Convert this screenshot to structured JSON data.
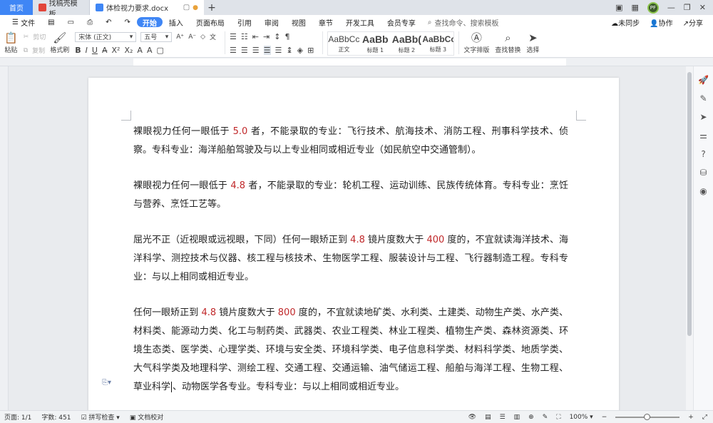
{
  "tabs": {
    "home": "首页",
    "template": "找稿壳模板",
    "document": "体检视力要求.docx"
  },
  "window": {
    "avatar_text": "PF"
  },
  "menu": {
    "file": "文件",
    "items": [
      "开始",
      "插入",
      "页面布局",
      "引用",
      "审阅",
      "视图",
      "章节",
      "开发工具",
      "会员专享"
    ],
    "search_placeholder": "查找命令、搜索模板",
    "sync": "未同步",
    "collab": "协作",
    "share": "分享"
  },
  "ribbon": {
    "cut": "剪切",
    "copy": "复制",
    "paste": "粘贴",
    "format_painter": "格式刷",
    "font_name": "宋体 (正文)",
    "font_size": "五号",
    "styles": [
      "正文",
      "标题 1",
      "标题 2",
      "标题 3"
    ],
    "style_preview": [
      "AaBbCc",
      "AaBb",
      "AaBb(",
      "AaBbCc"
    ],
    "text_layout": "文字排版",
    "find_replace": "查找替换",
    "select": "选择"
  },
  "document": {
    "paragraphs": [
      {
        "pre": "裸眼视力任何一眼低于 ",
        "num": "5.0",
        "post": " 者，不能录取的专业：飞行技术、航海技术、消防工程、刑事科学技术、侦察。专科专业：海洋船舶驾驶及与以上专业相同或相近专业（如民航空中交通管制）。"
      },
      {
        "pre": "裸眼视力任何一眼低于 ",
        "num": "4.8",
        "post": " 者，不能录取的专业：轮机工程、运动训练、民族传统体育。专科专业：烹饪与营养、烹饪工艺等。"
      }
    ],
    "p3": {
      "pre": "屈光不正（近视眼或远视眼，下同）任何一眼矫正到 ",
      "num1": "4.8",
      "mid": " 镜片度数大于 ",
      "num2": "400",
      "post": " 度的，不宜就读海洋技术、海洋科学、测控技术与仪器、核工程与核技术、生物医学工程、服装设计与工程、飞行器制造工程。专科专业：与以上相同或相近专业。"
    },
    "p4": {
      "pre": "任何一眼矫正到 ",
      "num1": "4.8",
      "mid": " 镜片度数大于 ",
      "num2": "800",
      "post_a": " 度的，不宜就读地矿类、水利类、土建类、动物生产类、水产类、材料类、能源动力类、化工与制药类、武器类、农业工程类、林业工程类、植物生产类、森林资源类、环境生态类、医学类、心理学类、环境与安全类、环境科学类、电子信息科学类、材料科学类、地质学类、大气科学类及地理科学、测绘工程、交通工程、交通运输、油气储运工程、船舶与海洋工程、生物工程、草业科学",
      "post_b": "、动物医学各专业。专科专业：与以上相同或相近专业。"
    }
  },
  "status": {
    "page": "页面: 1/1",
    "words": "字数: 451",
    "spell": "拼写检查",
    "proof": "文档校对",
    "zoom": "100%"
  },
  "colors": {
    "accent": "#3f86f5",
    "number_red": "#c0282a"
  }
}
